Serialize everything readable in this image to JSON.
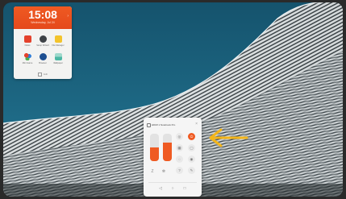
{
  "clock": {
    "time": "15:08",
    "date": "Wednesday, Jul 24",
    "footer_label": "Edit"
  },
  "apps": [
    {
      "label": "Notes",
      "icon": "notes-icon",
      "color": "#e4422c"
    },
    {
      "label": "Setup Wizard",
      "icon": "gear-icon",
      "color": "#3e4246"
    },
    {
      "label": "File Manager",
      "icon": "folder-icon",
      "color": "#f3c42c"
    },
    {
      "label": "Mini Game",
      "icon": "game-icon",
      "color": "#2f7ed8"
    },
    {
      "label": "Browser",
      "icon": "globe-icon",
      "color": "#1d4f91"
    },
    {
      "label": "Wallpaper",
      "icon": "landscape-icon",
      "color": "#4cb8a4"
    }
  ],
  "control_center": {
    "title": "HDMI 1 Notebook Pro",
    "brightness_level": 0.5,
    "volume_level": 0.68,
    "toggles": [
      {
        "icon": "eye-icon",
        "glyph": "◎",
        "on": false
      },
      {
        "icon": "power-icon",
        "glyph": "⏻",
        "on": true
      },
      {
        "icon": "grid-icon",
        "glyph": "▦",
        "on": false
      },
      {
        "icon": "screen-icon",
        "glyph": "▢",
        "on": false
      },
      {
        "icon": "mute-icon",
        "glyph": "◌",
        "on": false
      },
      {
        "icon": "target-icon",
        "glyph": "◉",
        "on": false
      },
      {
        "icon": "question-icon",
        "glyph": "?",
        "on": false
      },
      {
        "icon": "brush-icon",
        "glyph": "✎",
        "on": false
      }
    ],
    "bottom_tools": [
      {
        "icon": "timer-icon",
        "glyph": "Z"
      },
      {
        "icon": "snowflake-icon",
        "glyph": "✻"
      },
      {
        "icon": "settings-icon",
        "glyph": "⚙"
      },
      {
        "icon": "annotate-icon",
        "glyph": "↖"
      }
    ],
    "nav": [
      {
        "icon": "back-icon",
        "glyph": "◁"
      },
      {
        "icon": "home-icon",
        "glyph": "○"
      },
      {
        "icon": "recents-icon",
        "glyph": "□"
      }
    ]
  },
  "colors": {
    "accent": "#ef5a22",
    "arrow": "#f3b51a",
    "sky": "#1e6a86"
  }
}
